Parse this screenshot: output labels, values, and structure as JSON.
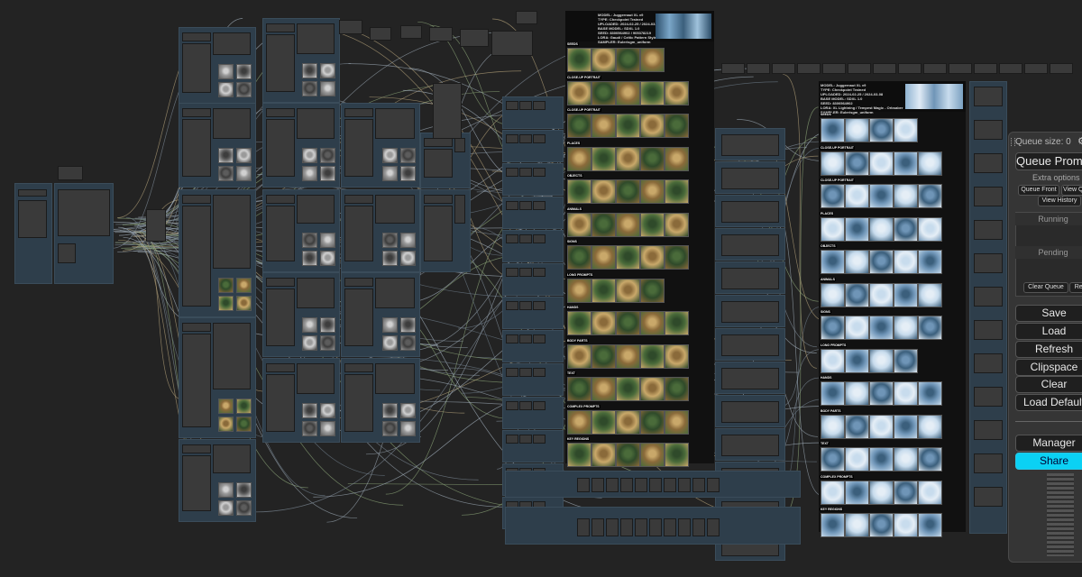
{
  "colors": {
    "canvas": "#232323",
    "group": "#2e3e4b",
    "node": "#3a3a3a",
    "menu": "#353535",
    "share": "#0bd1f4"
  },
  "menu": {
    "queue_size": "Queue size: 0",
    "gear_icon": "gear-icon",
    "queue_prompt": "Queue Prompt",
    "extra_options": "Extra options",
    "queue_front": "Queue Front",
    "view_queue": "View Queue",
    "view_history": "View History",
    "running": "Running",
    "pending": "Pending",
    "clear_queue": "Clear Queue",
    "refresh_small": "Refresh",
    "save": "Save",
    "load": "Load",
    "refresh": "Refresh",
    "clipspace": "Clipspace",
    "clear": "Clear",
    "load_default": "Load Default",
    "manager": "Manager",
    "share": "Share"
  },
  "gallery_left": {
    "header": "MODEL: Juggernaut XL v9\nTYPE: Checkpoint Trained\nUPLOADED: 2024-02-25 / 2024-03-08\nBASE MODEL: SDXL 1.0\nSEED: 8300564902 / 905378219\nLORA: Gaudi / Celtic Pattern Style\nSAMPLER: Euler/sgm_uniform",
    "sections": [
      "SEEDS",
      "CLOSE-UP PORTRAIT",
      "CLOSE-UP PORTRAIT",
      "PLACES",
      "OBJECTS",
      "ANIMALS",
      "SIGNS",
      "LONG PROMPTS",
      "HANDS",
      "BODY PARTS",
      "TEXT",
      "COMPLEX PROMPTS",
      "KEY REGIONS"
    ]
  },
  "gallery_right": {
    "header": "MODEL: Juggernaut XL v9\nTYPE: Checkpoint Trained\nUPLOADED: 2024-02-25 / 2024-03-08\nBASE MODEL: SDXL 1.0\nSEED: 8300564902\nLORA: XL Lightning / Tempest Magic - Orbsaber\nSAMPLER: Euler/sgm_uniform",
    "sections": [
      "SEEDS",
      "CLOSE-UP PORTRAIT",
      "CLOSE-UP PORTRAIT",
      "PLACES",
      "OBJECTS",
      "ANIMALS",
      "SIGNS",
      "LONG PROMPTS",
      "HANDS",
      "BODY PARTS",
      "TEXT",
      "COMPLEX PROMPTS",
      "KEY REGIONS"
    ]
  }
}
